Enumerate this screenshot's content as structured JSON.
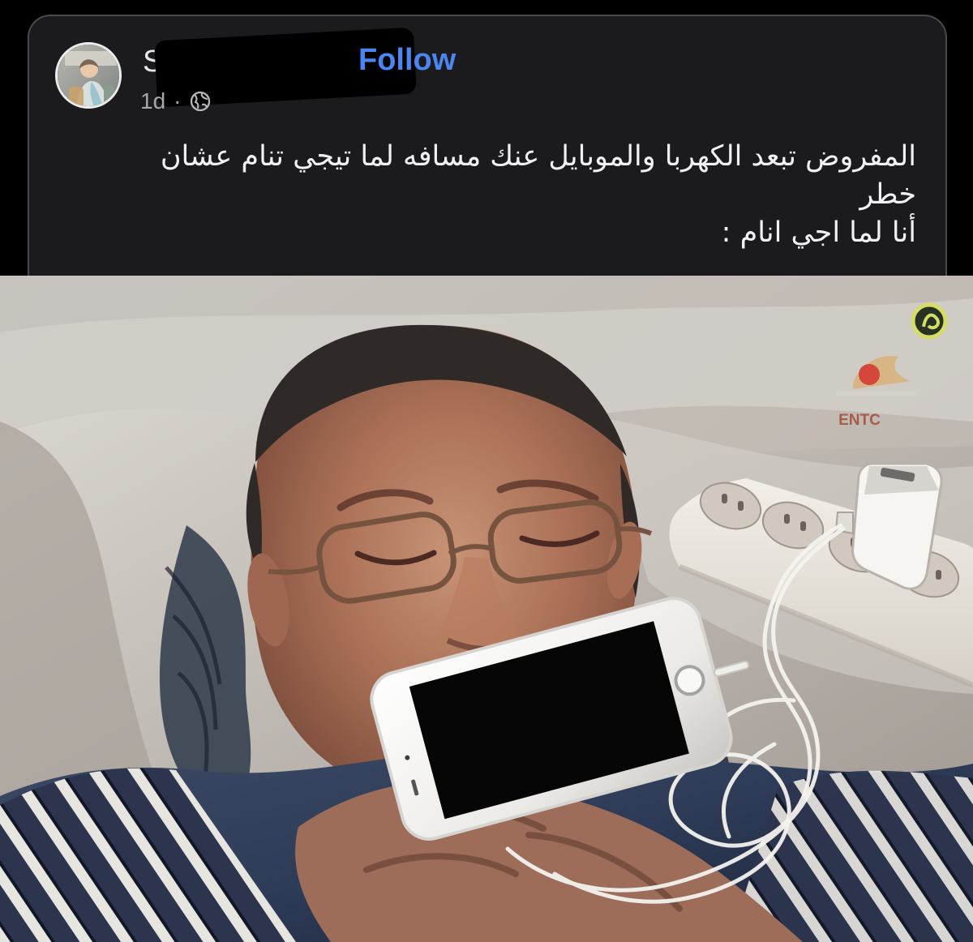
{
  "post": {
    "author_name": "S",
    "follow_label": "Follow",
    "time": "1d",
    "separator": "·",
    "privacy_icon": "globe-icon",
    "text_lines": [
      "المفروض تبعد الكهربا والموبايل عنك مسافه لما تيجي تنام عشان",
      "خطر",
      "أنا لما اجي انام :"
    ]
  },
  "image": {
    "watermark_text": "ENTC"
  },
  "colors": {
    "background": "#000000",
    "card": "#1b1b1d",
    "text": "#f1f1f1",
    "muted": "#a8a8ab",
    "link": "#4c84f0"
  }
}
